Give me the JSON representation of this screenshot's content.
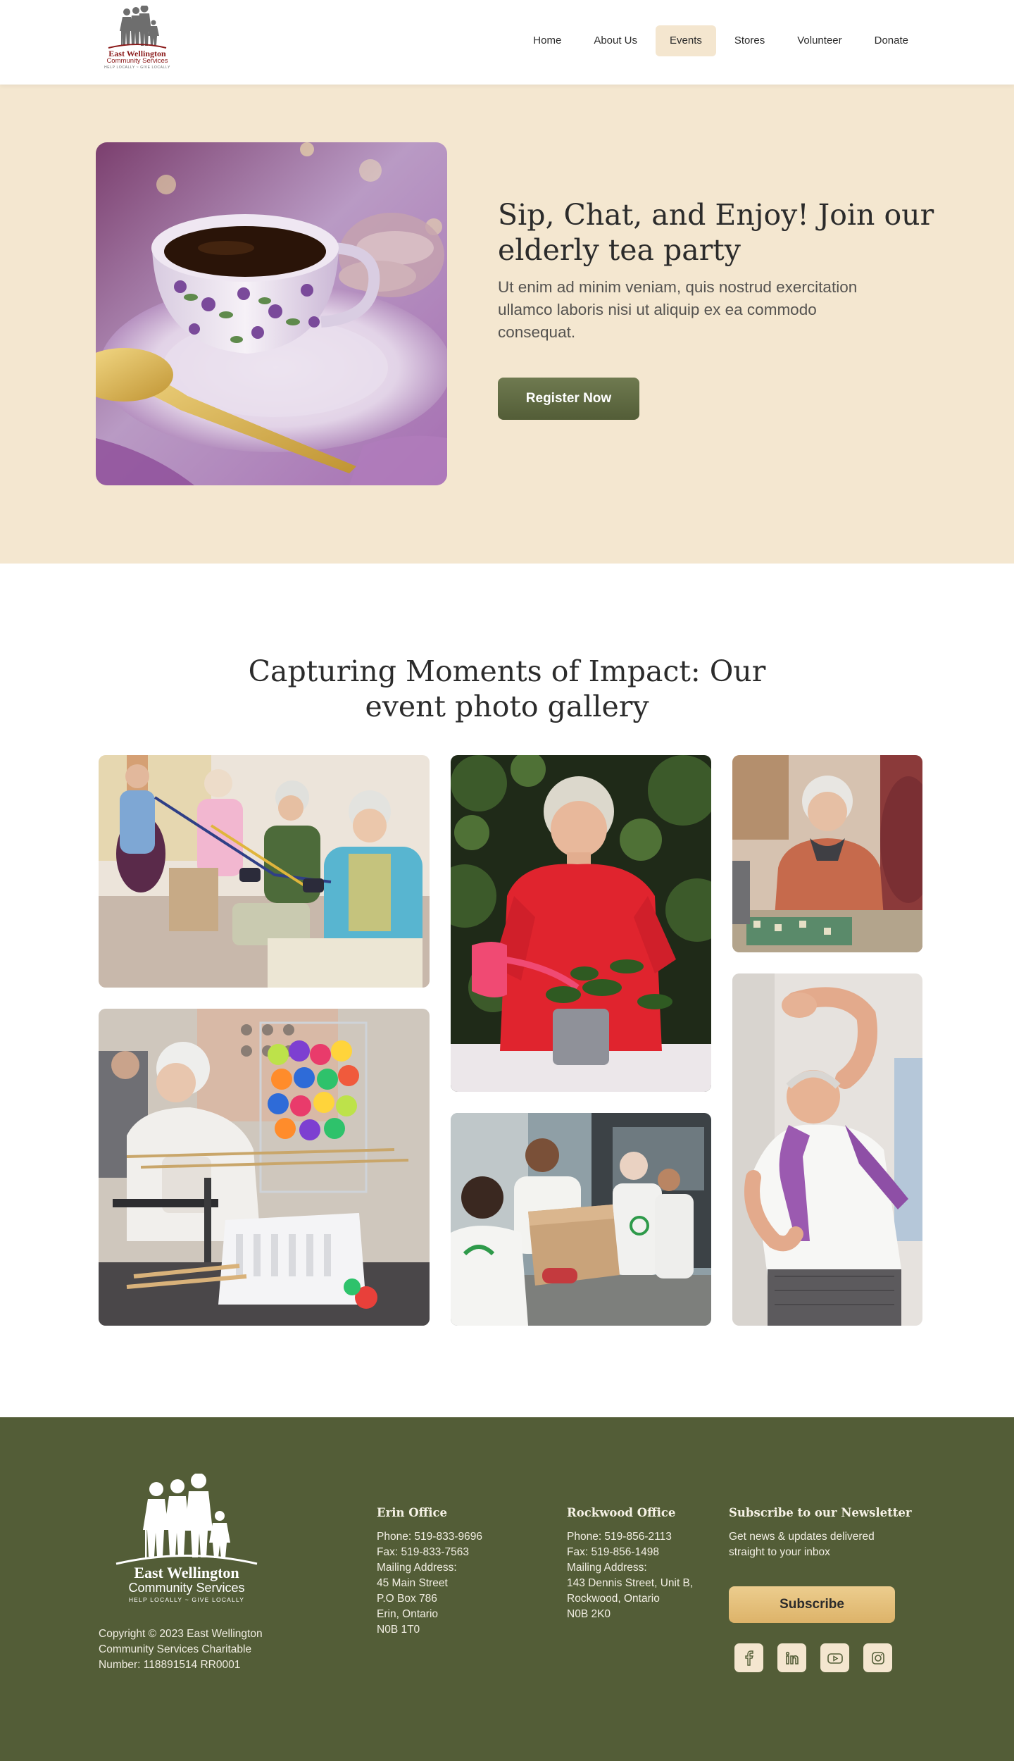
{
  "brand": {
    "name_line1": "East Wellington",
    "name_line2": "Community Services",
    "tagline": "HELP LOCALLY ~ GIVE LOCALLY",
    "primary_color": "#535d37",
    "accent_color": "#f4e7d0",
    "logo_red": "#8b1a1a"
  },
  "nav": {
    "items": [
      {
        "label": "Home",
        "active": false
      },
      {
        "label": "About Us",
        "active": false
      },
      {
        "label": "Events",
        "active": true
      },
      {
        "label": "Stores",
        "active": false
      },
      {
        "label": "Volunteer",
        "active": false
      },
      {
        "label": "Donate",
        "active": false
      }
    ]
  },
  "hero": {
    "title": "Sip, Chat, and Enjoy! Join our elderly tea party",
    "description": "Ut enim ad minim veniam, quis nostrud exercitation ullamco laboris nisi ut aliquip ex ea commodo consequat.",
    "cta_label": "Register Now",
    "image_icon": "teacup-photo"
  },
  "gallery": {
    "title": "Capturing Moments of Impact: Our event photo gallery",
    "photos": [
      {
        "icon": "seniors-exercise-bands-photo"
      },
      {
        "icon": "senior-watering-plant-photo"
      },
      {
        "icon": "senior-playing-board-game-photo"
      },
      {
        "icon": "senior-playing-kerplunk-photo"
      },
      {
        "icon": "volunteers-handing-box-photo"
      },
      {
        "icon": "senior-stretching-photo"
      }
    ]
  },
  "footer": {
    "copyright": "Copyright © 2023 East Wellington Community Services Charitable Number: 118891514 RR0001",
    "erin": {
      "title": "Erin Office",
      "lines": [
        "Phone: 519-833-9696",
        "Fax: 519-833-7563",
        "Mailing Address:",
        "45 Main Street",
        "P.O Box 786",
        "Erin, Ontario",
        "N0B 1T0"
      ]
    },
    "rockwood": {
      "title": "Rockwood Office",
      "lines": [
        "Phone: 519-856-2113",
        "Fax: 519-856-1498",
        "Mailing Address:",
        "143 Dennis Street, Unit B,",
        "Rockwood, Ontario",
        "N0B 2K0"
      ]
    },
    "newsletter": {
      "title": "Subscribe to our Newsletter",
      "description": "Get news & updates delivered straight to your inbox",
      "button_label": "Subscribe"
    },
    "socials": [
      {
        "icon": "facebook-icon"
      },
      {
        "icon": "linkedin-icon"
      },
      {
        "icon": "youtube-icon"
      },
      {
        "icon": "instagram-icon"
      }
    ]
  }
}
